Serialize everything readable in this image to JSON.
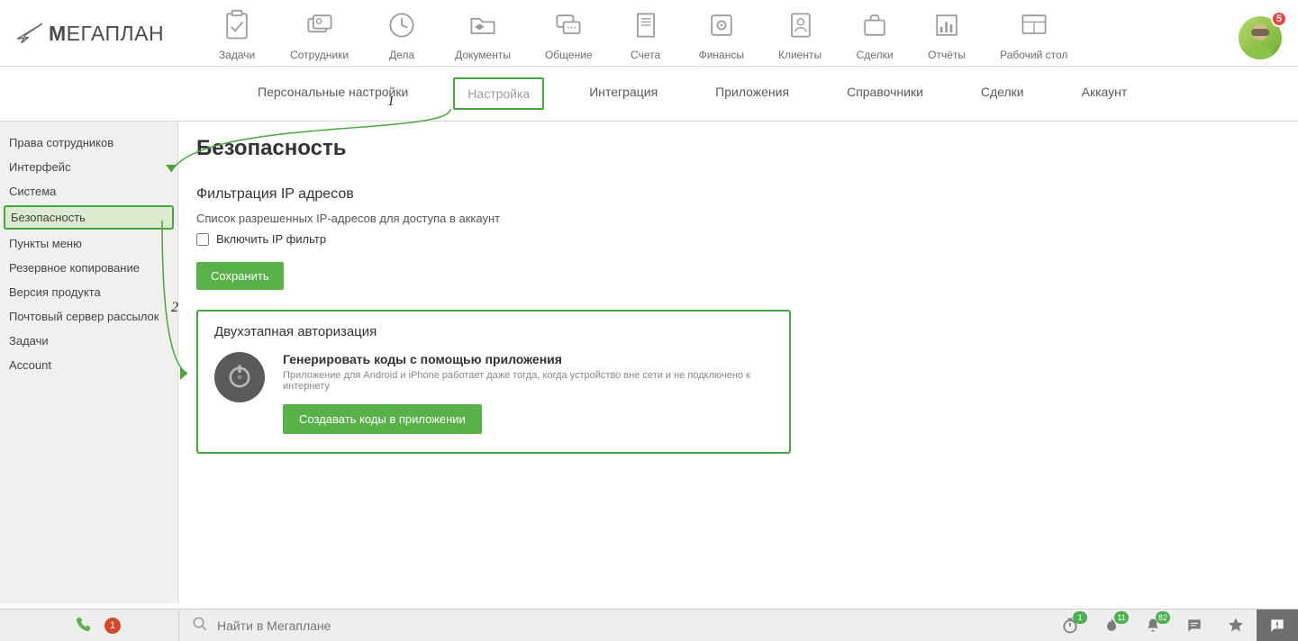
{
  "logo": {
    "text": "ЕГАПЛАН"
  },
  "topnav": [
    {
      "label": "Задачи"
    },
    {
      "label": "Сотрудники"
    },
    {
      "label": "Дела"
    },
    {
      "label": "Документы"
    },
    {
      "label": "Общение"
    },
    {
      "label": "Счета"
    },
    {
      "label": "Финансы"
    },
    {
      "label": "Клиенты"
    },
    {
      "label": "Сделки"
    },
    {
      "label": "Отчёты"
    },
    {
      "label": "Рабочий стол"
    }
  ],
  "avatar_badge": "5",
  "subnav": [
    {
      "label": "Персональные настройки"
    },
    {
      "label": "Настройка",
      "active": true
    },
    {
      "label": "Интеграция"
    },
    {
      "label": "Приложения"
    },
    {
      "label": "Справочники"
    },
    {
      "label": "Сделки"
    },
    {
      "label": "Аккаунт"
    }
  ],
  "annotations": {
    "one": "1",
    "two": "2"
  },
  "sidebar": [
    {
      "label": "Права сотрудников"
    },
    {
      "label": "Интерфейс"
    },
    {
      "label": "Система"
    },
    {
      "label": "Безопасность",
      "active": true
    },
    {
      "label": "Пункты меню"
    },
    {
      "label": "Резервное копирование"
    },
    {
      "label": "Версия продукта"
    },
    {
      "label": "Почтовый сервер рассылок"
    },
    {
      "label": "Задачи"
    },
    {
      "label": "Account"
    }
  ],
  "content": {
    "title": "Безопасность",
    "ip_section_title": "Фильтрация IP адресов",
    "ip_desc": "Список разрешенных IP-адресов для доступа в аккаунт",
    "ip_checkbox_label": "Включить IP фильтр",
    "save_btn": "Сохранить",
    "twofa_title": "Двухэтапная авторизация",
    "twofa_heading": "Генерировать коды с помощью приложения",
    "twofa_desc": "Приложение для Android и iPhone работает даже тогда, когда устройство вне сети и не подключено к интернету",
    "twofa_btn": "Создавать коды в приложении"
  },
  "bottombar": {
    "phone_badge": "1",
    "search_placeholder": "Найти в Мегаплане",
    "timer_badge": "1",
    "fire_badge": "11",
    "bell_badge": "82"
  }
}
